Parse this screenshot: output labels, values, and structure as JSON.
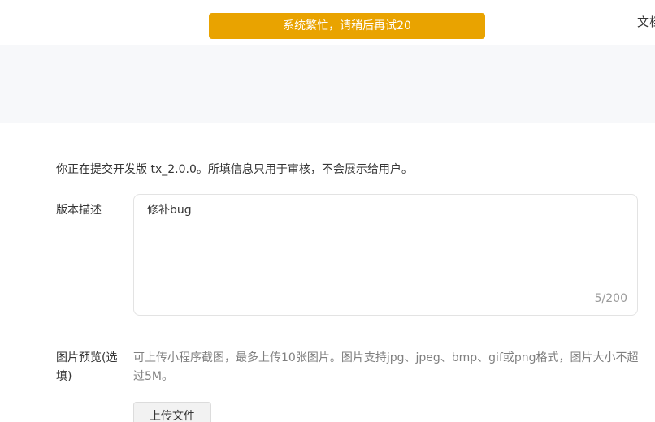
{
  "toast": {
    "message": "系统繁忙，请稍后再试20"
  },
  "topbar": {
    "link_label": "文档"
  },
  "form": {
    "notice": "你正在提交开发版 tx_2.0.0。所填信息只用于审核，不会展示给用户。",
    "description": {
      "label": "版本描述",
      "value": "修补bug",
      "counter": "5/200"
    },
    "image_preview": {
      "label": "图片预览(选填)",
      "hint": "可上传小程序截图，最多上传10张图片。图片支持jpg、jpeg、bmp、gif或png格式，图片大小不超过5M。",
      "upload_button": "上传文件"
    }
  },
  "colors": {
    "toast_bg": "#e9a300",
    "page_band": "#f7f8fa"
  }
}
